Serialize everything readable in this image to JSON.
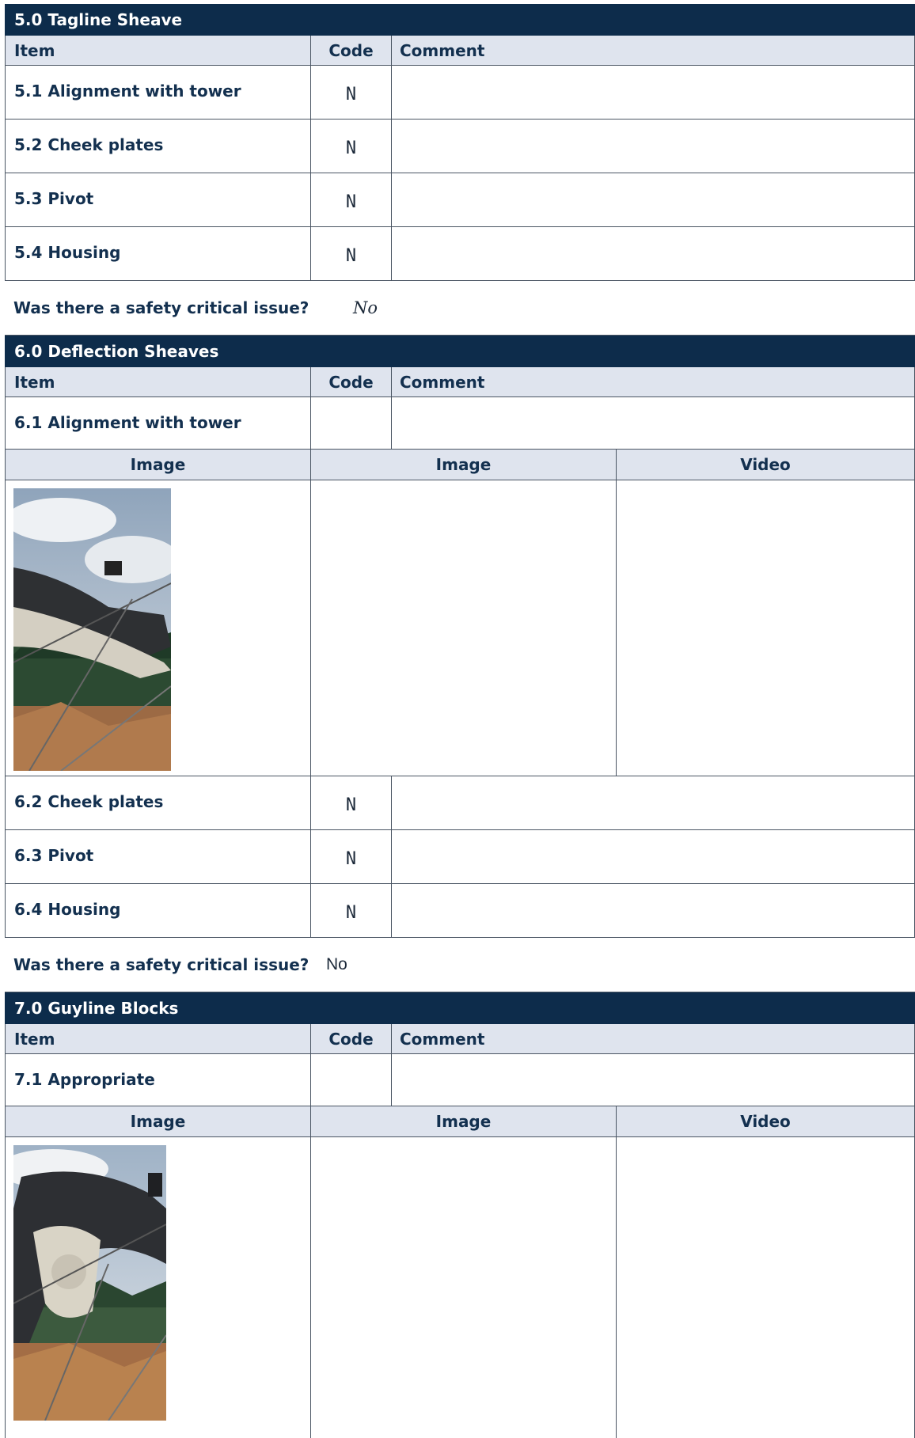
{
  "sections": [
    {
      "title": "5.0  Tagline Sheave",
      "headers": {
        "item": "Item",
        "code": "Code",
        "comment": "Comment"
      },
      "items": [
        {
          "label": "5.1  Alignment with tower",
          "code": "N",
          "comment": ""
        },
        {
          "label": "5.2  Cheek plates",
          "code": "N",
          "comment": ""
        },
        {
          "label": "5.3  Pivot",
          "code": "N",
          "comment": ""
        },
        {
          "label": "5.4  Housing",
          "code": "N",
          "comment": ""
        }
      ],
      "safety": {
        "question": "Was there a safety critical issue?",
        "answer": "No"
      }
    },
    {
      "title": "6.0  Deflection Sheaves",
      "headers": {
        "item": "Item",
        "code": "Code",
        "comment": "Comment"
      },
      "first_item": {
        "label": "6.1 Alignment with tower",
        "code": "",
        "comment": ""
      },
      "media_headers": [
        "Image",
        "Image",
        "Video"
      ],
      "items": [
        {
          "label": "6.2  Cheek plates",
          "code": "N",
          "comment": ""
        },
        {
          "label": "6.3  Pivot",
          "code": "N",
          "comment": ""
        },
        {
          "label": "6.4  Housing",
          "code": "N",
          "comment": ""
        }
      ],
      "safety": {
        "question": "Was there a safety critical issue?",
        "answer": "No"
      }
    },
    {
      "title": "7.0  Guyline Blocks",
      "headers": {
        "item": "Item",
        "code": "Code",
        "comment": "Comment"
      },
      "first_item": {
        "label": "7.1  Appropriate",
        "code": "",
        "comment": ""
      },
      "media_headers": [
        "Image",
        "Image",
        "Video"
      ]
    }
  ],
  "colors": {
    "section_bar": "#0d2c4b",
    "header_bg": "#dfe4ee",
    "text": "#13304f"
  }
}
